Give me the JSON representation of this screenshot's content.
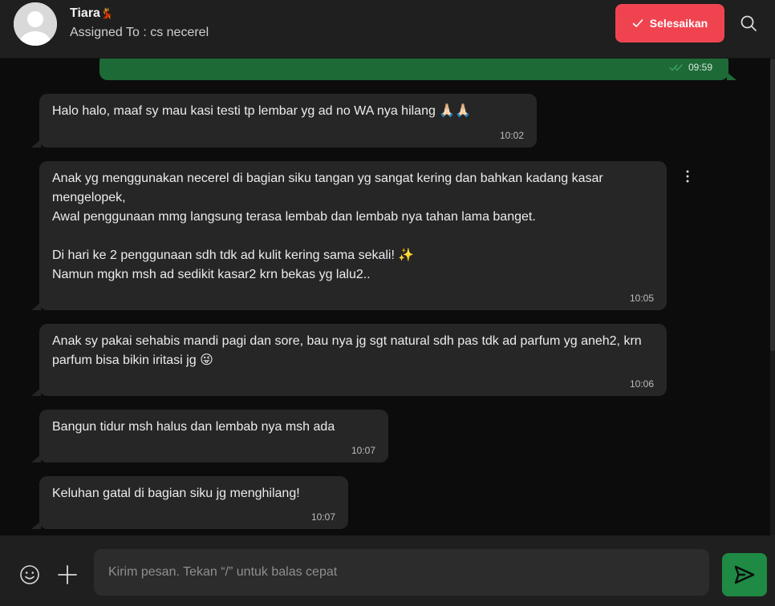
{
  "header": {
    "contact_name": "Tiara",
    "name_emoji": "💃",
    "assigned_label": "Assigned To : cs necerel",
    "finish_label": "Selesaikan"
  },
  "messages": [
    {
      "direction": "out",
      "text": "",
      "time": "09:59",
      "status": "read"
    },
    {
      "direction": "in",
      "text": "Halo halo, maaf sy mau kasi testi tp lembar yg ad no WA nya hilang 🙏🏻🙏🏻",
      "time": "10:02"
    },
    {
      "direction": "in",
      "text": "Anak yg menggunakan necerel di bagian siku tangan yg sangat kering dan bahkan kadang kasar mengelopek,\nAwal penggunaan mmg langsung terasa lembab dan lembab nya tahan lama banget.\n\nDi hari ke 2 penggunaan sdh tdk ad kulit kering sama sekali! ✨\nNamun mgkn msh ad sedikit kasar2 krn bekas yg lalu2..",
      "time": "10:05"
    },
    {
      "direction": "in",
      "text": "Anak sy pakai sehabis mandi pagi dan sore, bau nya jg sgt natural sdh pas tdk ad parfum yg aneh2, krn parfum bisa bikin iritasi jg 😜",
      "time": "10:06"
    },
    {
      "direction": "in",
      "text": "Bangun tidur msh halus dan lembab nya msh ada",
      "time": "10:07"
    },
    {
      "direction": "in",
      "text": "Keluhan gatal di bagian siku jg menghilang!",
      "time": "10:07"
    }
  ],
  "composer": {
    "placeholder": "Kirim pesan. Tekan “/” untuk balas cepat"
  },
  "colors": {
    "finish_button": "#ef4450",
    "outgoing_bubble": "#1e6a37",
    "incoming_bubble": "#262626",
    "send_button": "#1e8a43"
  },
  "icons": [
    "avatar-placeholder-icon",
    "check-icon",
    "search-icon",
    "double-check-icon",
    "more-vertical-icon",
    "emoji-icon",
    "plus-icon",
    "send-icon"
  ]
}
